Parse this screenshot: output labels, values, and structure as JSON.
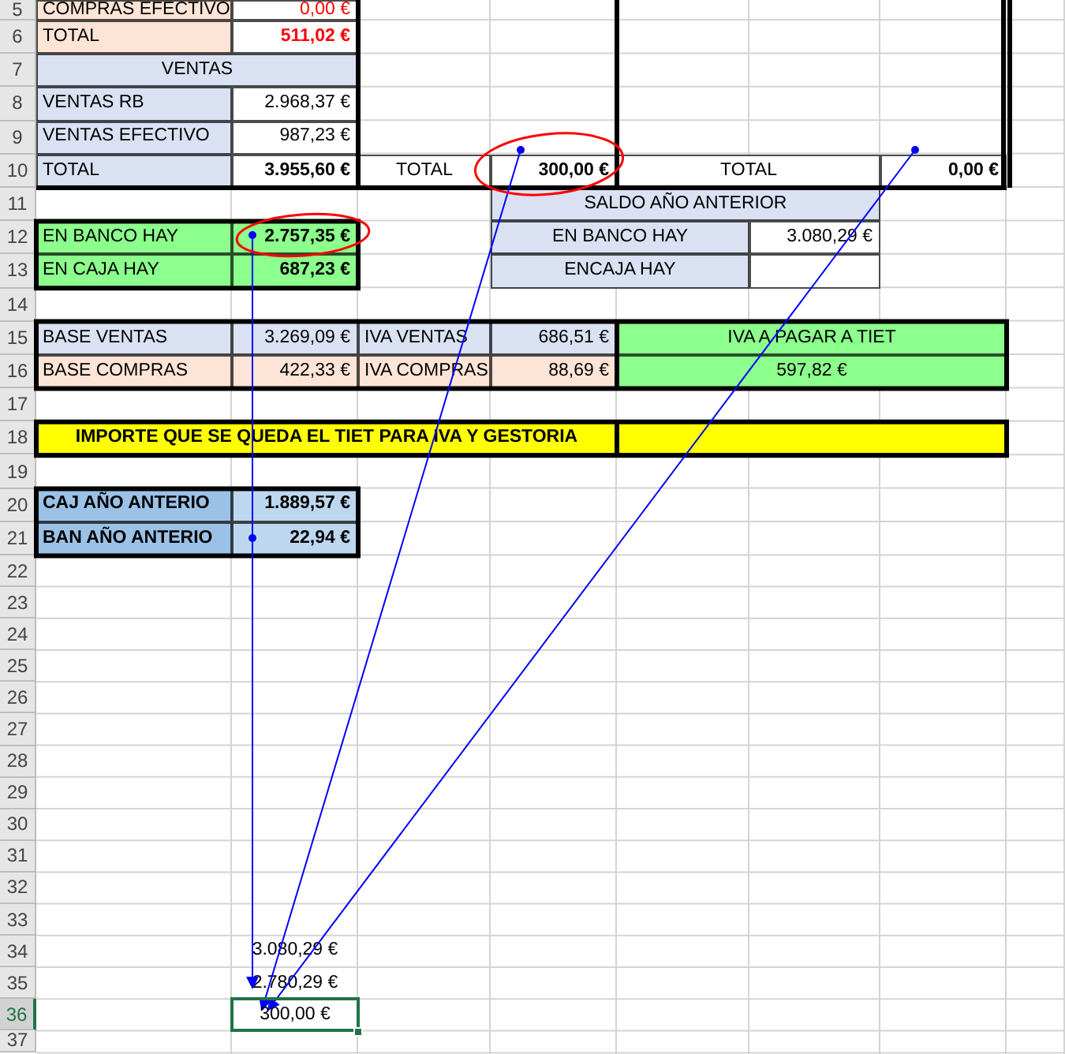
{
  "rows": [
    {
      "number": "5",
      "selected": false,
      "cells": [
        {
          "kind": "label",
          "text": "COMPRAS EFECTIVO",
          "color": "#fce4d6",
          "selected": false
        },
        {
          "kind": "warning",
          "text": "0,00 €",
          "color": "#ffffff",
          "selected": false
        }
      ]
    },
    {
      "number": "6",
      "selected": false,
      "cells": [
        {
          "kind": "label",
          "text": "TOTAL",
          "color": "#fce4d6",
          "selected": false
        },
        {
          "kind": "warning",
          "text": "511,02 €",
          "bold": true,
          "color": "#ffffff",
          "selected": false
        }
      ]
    },
    {
      "number": "7",
      "selected": false,
      "cells": [
        {
          "kind": "heading",
          "text": "VENTAS",
          "color": "#d9e1f2",
          "selected": false
        }
      ]
    },
    {
      "number": "8",
      "selected": false,
      "cells": [
        {
          "kind": "label",
          "text": "VENTAS RB",
          "color": "#d9e1f2",
          "selected": false
        },
        {
          "kind": "number",
          "text": "2.968,37 €",
          "color": "#ffffff",
          "selected": false
        }
      ]
    },
    {
      "number": "9",
      "selected": false,
      "cells": [
        {
          "kind": "label",
          "text": "VENTAS EFECTIVO",
          "color": "#d9e1f2",
          "selected": false
        },
        {
          "kind": "number",
          "text": "987,23 €",
          "color": "#ffffff",
          "selected": false
        }
      ]
    },
    {
      "number": "10",
      "selected": false,
      "cells": [
        {
          "kind": "label",
          "text": "TOTAL",
          "color": "#d9e1f2",
          "selected": false
        },
        {
          "kind": "number",
          "text": "3.955,60 €",
          "bold": true,
          "color": "#ffffff",
          "selected": false
        },
        {
          "kind": "heading",
          "text": "TOTAL",
          "color": "#ffffff",
          "selected": false
        },
        {
          "kind": "number",
          "text": "300,00 €",
          "bold": true,
          "color": "#ffffff",
          "selected": false
        },
        {
          "kind": "heading",
          "text": "TOTAL",
          "color": "#ffffff",
          "selected": false
        },
        {
          "kind": "number",
          "text": "0,00 €",
          "bold": true,
          "color": "#ffffff",
          "selected": false
        }
      ]
    },
    {
      "number": "11",
      "selected": false,
      "cells": [
        {
          "kind": "heading",
          "text": "SALDO AÑO ANTERIOR",
          "color": "#d9e1f2",
          "selected": false
        }
      ]
    },
    {
      "number": "12",
      "selected": false,
      "cells": [
        {
          "kind": "label",
          "text": "EN BANCO HAY",
          "color": "#8cff8c",
          "selected": false
        },
        {
          "kind": "number",
          "text": "2.757,35 €",
          "bold": true,
          "color": "#8cff8c",
          "selected": false
        },
        {
          "kind": "heading",
          "text": "EN BANCO HAY",
          "color": "#d9e1f2",
          "selected": false
        },
        {
          "kind": "number",
          "text": "3.080,29 €",
          "color": "#ffffff",
          "selected": false
        }
      ]
    },
    {
      "number": "13",
      "selected": false,
      "cells": [
        {
          "kind": "label",
          "text": "EN CAJA HAY",
          "color": "#8cff8c",
          "selected": false
        },
        {
          "kind": "number",
          "text": "687,23 €",
          "bold": true,
          "color": "#8cff8c",
          "selected": false
        },
        {
          "kind": "heading",
          "text": "ENCAJA HAY",
          "color": "#d9e1f2",
          "selected": false
        },
        {
          "kind": "number",
          "color": "#ffffff",
          "selected": false
        }
      ]
    },
    {
      "number": "14",
      "selected": false
    },
    {
      "number": "15",
      "selected": false,
      "cells": [
        {
          "kind": "label",
          "text": "BASE VENTAS",
          "color": "#d9e1f2",
          "selected": false
        },
        {
          "kind": "number",
          "text": "3.269,09 €",
          "color": "#d9e1f2",
          "selected": false
        },
        {
          "kind": "label",
          "text": "IVA VENTAS",
          "color": "#d9e1f2",
          "selected": false
        },
        {
          "kind": "number",
          "text": "686,51 €",
          "color": "#d9e1f2",
          "selected": false
        },
        {
          "kind": "heading",
          "text": "IVA A PAGAR A TIET",
          "color": "#8cff8c",
          "selected": false
        }
      ]
    },
    {
      "number": "16",
      "selected": false,
      "cells": [
        {
          "kind": "label",
          "text": "BASE COMPRAS",
          "color": "#fce4d6",
          "selected": false
        },
        {
          "kind": "number",
          "text": "422,33 €",
          "color": "#fce4d6",
          "selected": false
        },
        {
          "kind": "label",
          "text": "IVA COMPRAS",
          "color": "#fce4d6",
          "selected": false
        },
        {
          "kind": "number",
          "text": "88,69 €",
          "color": "#fce4d6",
          "selected": false
        },
        {
          "kind": "heading",
          "text": "597,82 €",
          "color": "#8cff8c",
          "selected": false
        }
      ]
    },
    {
      "number": "17",
      "selected": false
    },
    {
      "number": "18",
      "selected": false,
      "cells": [
        {
          "kind": "heading",
          "text": "IMPORTE QUE SE QUEDA EL TIET PARA IVA Y GESTORIA",
          "bold": true,
          "color": "#ffff00",
          "selected": false
        },
        {
          "kind": "heading",
          "color": "#ffff00",
          "selected": false
        }
      ]
    },
    {
      "number": "19",
      "selected": false
    },
    {
      "number": "20",
      "selected": false,
      "cells": [
        {
          "kind": "label",
          "text": "CAJ AÑO ANTERIO",
          "bold": true,
          "color": "#9bc2e6",
          "selected": false
        },
        {
          "kind": "number",
          "text": "1.889,57 €",
          "bold": true,
          "color": "#bdd7ee",
          "selected": false
        }
      ]
    },
    {
      "number": "21",
      "selected": false,
      "cells": [
        {
          "kind": "label",
          "text": "BAN AÑO ANTERIO",
          "bold": true,
          "color": "#9bc2e6",
          "selected": false
        },
        {
          "kind": "number",
          "text": "22,94 €",
          "bold": true,
          "color": "#bdd7ee",
          "selected": false
        }
      ]
    },
    {
      "number": "22",
      "selected": false
    },
    {
      "number": "23",
      "selected": false
    },
    {
      "number": "24",
      "selected": false
    },
    {
      "number": "25",
      "selected": false
    },
    {
      "number": "26",
      "selected": false
    },
    {
      "number": "27",
      "selected": false
    },
    {
      "number": "28",
      "selected": false
    },
    {
      "number": "29",
      "selected": false
    },
    {
      "number": "30",
      "selected": false
    },
    {
      "number": "31",
      "selected": false
    },
    {
      "number": "32",
      "selected": false
    },
    {
      "number": "33",
      "selected": false
    },
    {
      "number": "34",
      "selected": false,
      "cells": [
        {
          "kind": "heading",
          "text": "3.080,29 €",
          "selected": false
        }
      ]
    },
    {
      "number": "35",
      "selected": false,
      "cells": [
        {
          "kind": "heading",
          "text": "2.780,29 €",
          "selected": false
        }
      ]
    },
    {
      "number": "36",
      "selected": true,
      "cells": [
        {
          "kind": "heading",
          "text": "300,00 €",
          "selected": true
        }
      ]
    },
    {
      "number": "37",
      "selected": false
    }
  ]
}
